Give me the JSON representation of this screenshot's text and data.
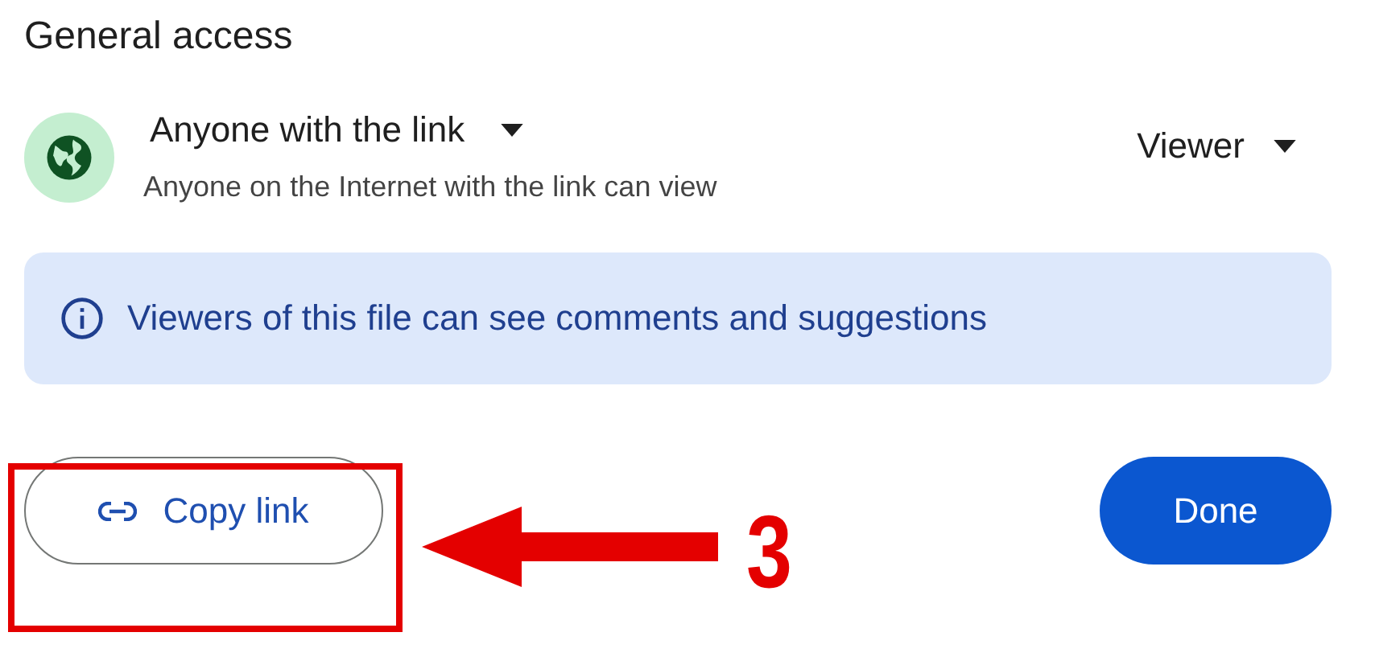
{
  "title": "General access",
  "access": {
    "label": "Anyone with the link",
    "description": "Anyone on the Internet with the link can view",
    "role": "Viewer"
  },
  "notice": {
    "text": "Viewers of this file can see comments and suggestions"
  },
  "buttons": [
    {
      "kind": "outlined",
      "label": "Copy link"
    },
    {
      "kind": "filled",
      "label": "Done"
    }
  ],
  "annotation": {
    "label": "3"
  }
}
